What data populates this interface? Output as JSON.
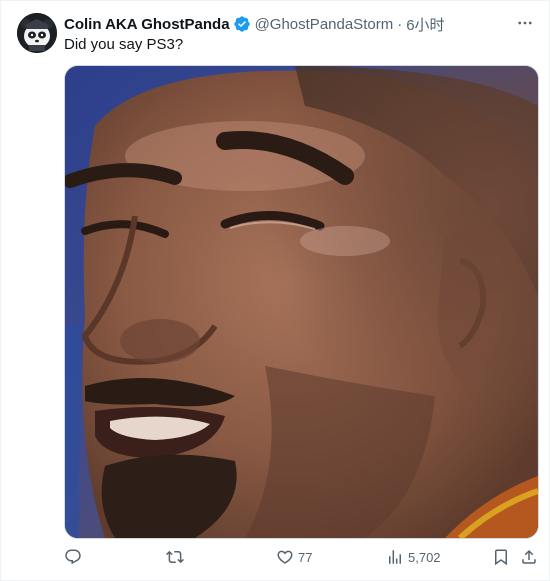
{
  "tweet": {
    "author_name": "Colin AKA GhostPanda",
    "handle": "@GhostPandaStorm",
    "separator": "·",
    "time": "6小时",
    "text": "Did you say PS3?",
    "avatar_icon": "panda-avatar-icon",
    "verified_icon": "verified-badge-icon",
    "verified_color": "#1d9bf0"
  },
  "actions": {
    "reply_count": "",
    "retweet_count": "",
    "like_count": "77",
    "views_count": "5,702"
  },
  "colors": {
    "text_primary": "#0f1419",
    "text_secondary": "#536471",
    "border": "#cfd9de"
  }
}
